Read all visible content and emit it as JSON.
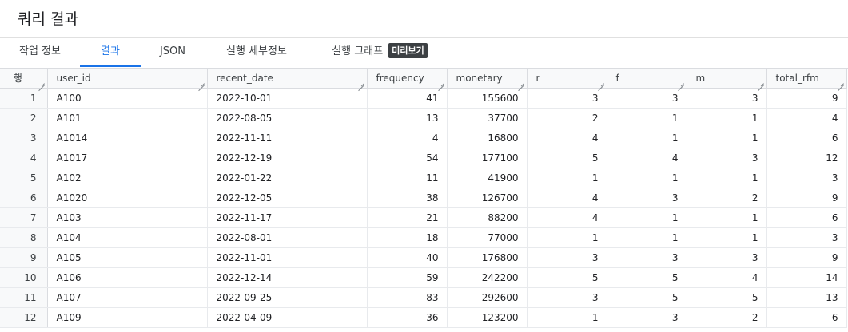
{
  "title": "쿼리 결과",
  "tabs": [
    {
      "label": "작업 정보",
      "active": false
    },
    {
      "label": "결과",
      "active": true
    },
    {
      "label": "JSON",
      "active": false
    },
    {
      "label": "실행 세부정보",
      "active": false
    },
    {
      "label": "실행 그래프",
      "active": false,
      "badge": "미리보기"
    }
  ],
  "table": {
    "rownum_header": "행",
    "columns": [
      "user_id",
      "recent_date",
      "frequency",
      "monetary",
      "r",
      "f",
      "m",
      "total_rfm"
    ],
    "rows": [
      {
        "n": "1",
        "user_id": "A100",
        "recent_date": "2022-10-01",
        "frequency": "41",
        "monetary": "155600",
        "r": "3",
        "f": "3",
        "m": "3",
        "total_rfm": "9"
      },
      {
        "n": "2",
        "user_id": "A101",
        "recent_date": "2022-08-05",
        "frequency": "13",
        "monetary": "37700",
        "r": "2",
        "f": "1",
        "m": "1",
        "total_rfm": "4"
      },
      {
        "n": "3",
        "user_id": "A1014",
        "recent_date": "2022-11-11",
        "frequency": "4",
        "monetary": "16800",
        "r": "4",
        "f": "1",
        "m": "1",
        "total_rfm": "6"
      },
      {
        "n": "4",
        "user_id": "A1017",
        "recent_date": "2022-12-19",
        "frequency": "54",
        "monetary": "177100",
        "r": "5",
        "f": "4",
        "m": "3",
        "total_rfm": "12"
      },
      {
        "n": "5",
        "user_id": "A102",
        "recent_date": "2022-01-22",
        "frequency": "11",
        "monetary": "41900",
        "r": "1",
        "f": "1",
        "m": "1",
        "total_rfm": "3"
      },
      {
        "n": "6",
        "user_id": "A1020",
        "recent_date": "2022-12-05",
        "frequency": "38",
        "monetary": "126700",
        "r": "4",
        "f": "3",
        "m": "2",
        "total_rfm": "9"
      },
      {
        "n": "7",
        "user_id": "A103",
        "recent_date": "2022-11-17",
        "frequency": "21",
        "monetary": "88200",
        "r": "4",
        "f": "1",
        "m": "1",
        "total_rfm": "6"
      },
      {
        "n": "8",
        "user_id": "A104",
        "recent_date": "2022-08-01",
        "frequency": "18",
        "monetary": "77000",
        "r": "1",
        "f": "1",
        "m": "1",
        "total_rfm": "3"
      },
      {
        "n": "9",
        "user_id": "A105",
        "recent_date": "2022-11-01",
        "frequency": "40",
        "monetary": "176800",
        "r": "3",
        "f": "3",
        "m": "3",
        "total_rfm": "9"
      },
      {
        "n": "10",
        "user_id": "A106",
        "recent_date": "2022-12-14",
        "frequency": "59",
        "monetary": "242200",
        "r": "5",
        "f": "5",
        "m": "4",
        "total_rfm": "14"
      },
      {
        "n": "11",
        "user_id": "A107",
        "recent_date": "2022-09-25",
        "frequency": "83",
        "monetary": "292600",
        "r": "3",
        "f": "5",
        "m": "5",
        "total_rfm": "13"
      },
      {
        "n": "12",
        "user_id": "A109",
        "recent_date": "2022-04-09",
        "frequency": "36",
        "monetary": "123200",
        "r": "1",
        "f": "3",
        "m": "2",
        "total_rfm": "6"
      }
    ]
  },
  "colors": {
    "accent": "#1a73e8",
    "badge_bg": "#3c4043",
    "header_bg": "#f8f9fa"
  }
}
